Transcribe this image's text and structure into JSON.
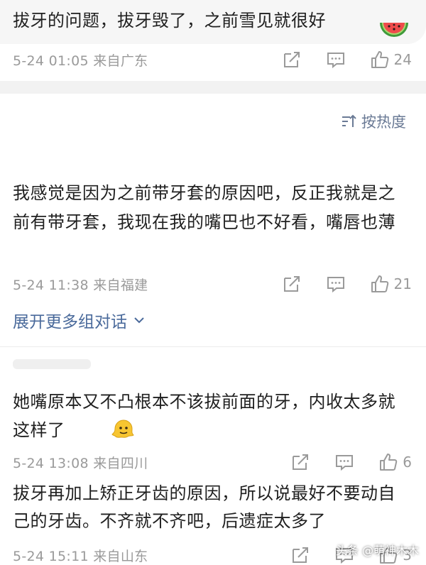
{
  "comments": [
    {
      "text": "拔牙的问题，拔牙毁了，之前雪见就很好",
      "time": "5-24 01:05 来自广东",
      "likes": "24",
      "emoji": "watermelon-icon"
    },
    {
      "text": "我感觉是因为之前带牙套的原因吧，反正我就是之前有带牙套，我现在我的嘴巴也不好看，嘴唇也薄",
      "time": "5-24 11:38 来自福建",
      "likes": "21"
    },
    {
      "text": "她嘴原本又不凸根本不该拔前面的牙，内收太多就这样了",
      "time": "5-24 13:08 来自四川",
      "likes": "6",
      "emoji": "melting-face-icon"
    },
    {
      "text": "拔牙再加上矫正牙齿的原因，所以说最好不要动自己的牙齿。不齐就不齐吧，后遗症太多了",
      "time": "5-24 15:11 来自山东",
      "likes": "3"
    }
  ],
  "sort_label": "按热度",
  "expand_label": "展开更多组对话",
  "watermark": "头条 @萌神木木",
  "colors": {
    "meta_gray": "#9a9a9a",
    "link_blue": "#4a6a9b",
    "band_gray": "#f2f2f2"
  }
}
